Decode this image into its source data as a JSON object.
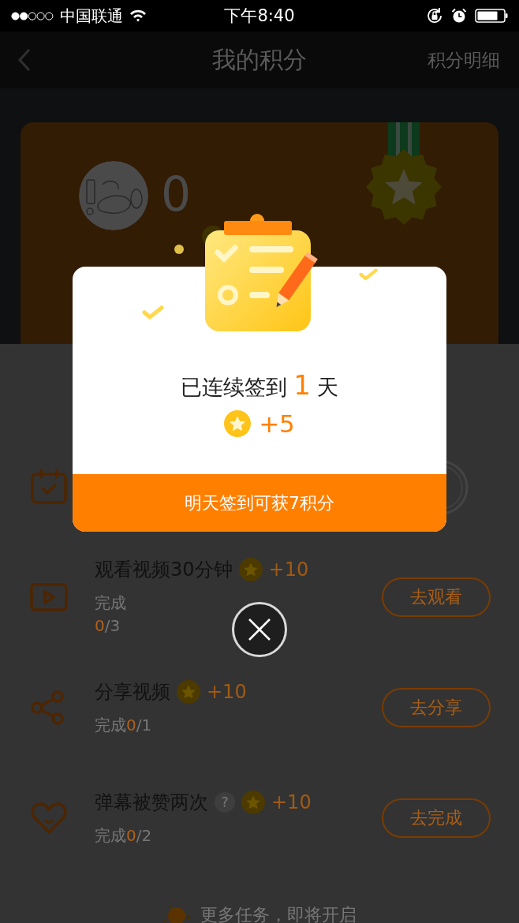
{
  "status_bar": {
    "carrier": "中国联通",
    "time": "下午8:40"
  },
  "nav": {
    "title": "我的积分",
    "action": "积分明细"
  },
  "header": {
    "points": "0"
  },
  "tasks": [
    {
      "kind": "calendar",
      "stamped": true
    },
    {
      "kind": "video",
      "title": "观看视频30分钟",
      "reward": "+10",
      "progress_label": "完成",
      "progress_done": "0",
      "progress_total": "/3",
      "button": "去观看"
    },
    {
      "kind": "share",
      "title": "分享视频",
      "reward": "+10",
      "progress_label": "完成",
      "progress_done": "0",
      "progress_total": "/1",
      "button": "去分享"
    },
    {
      "kind": "heart",
      "title": "弹幕被赞两次",
      "help_mark": "?",
      "reward": "+10",
      "progress_label": "完成",
      "progress_done": "0",
      "progress_total": "/2",
      "button": "去完成"
    }
  ],
  "footer": "更多任务，即将开启",
  "dialog": {
    "streak_prefix": "已连续签到",
    "streak_days": "1",
    "streak_suffix": "天",
    "reward": "+5",
    "action": "明天签到可获7积分"
  }
}
